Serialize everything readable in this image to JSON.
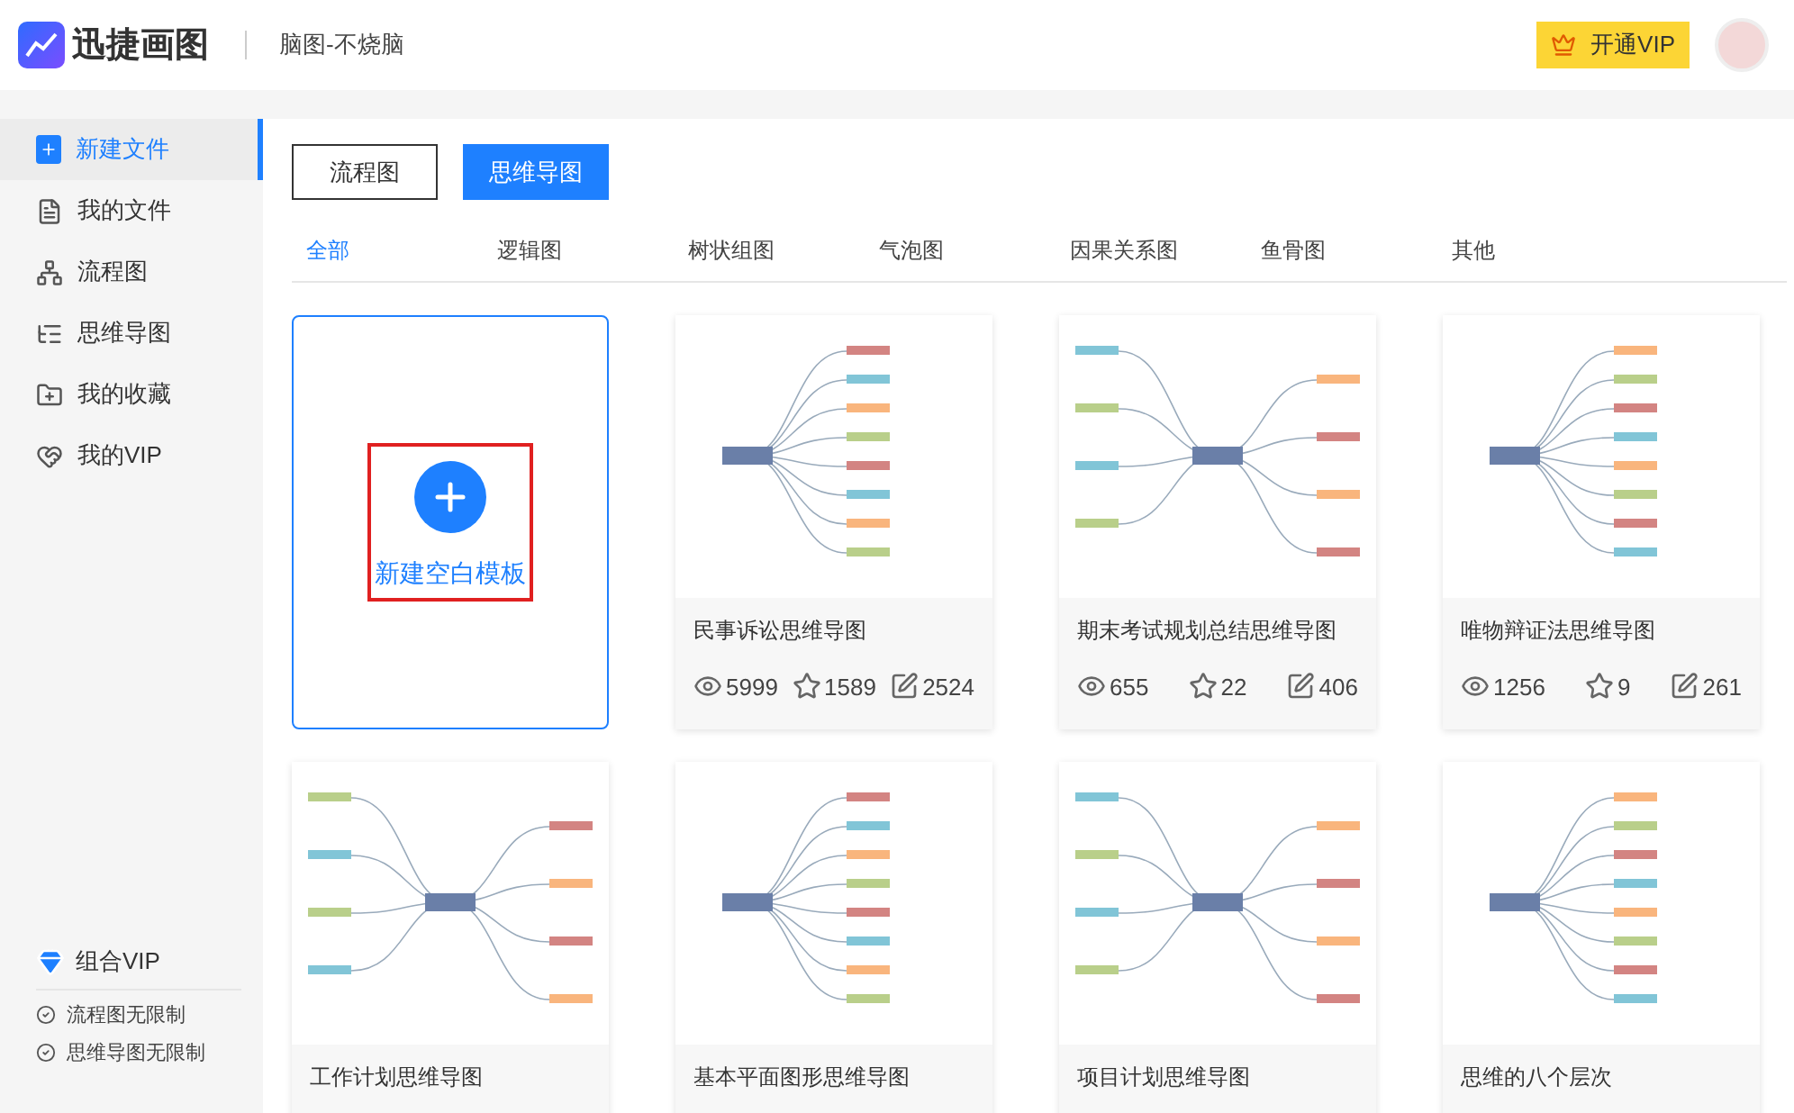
{
  "header": {
    "logo": "迅捷画图",
    "doc_title": "脑图-不烧脑",
    "vip_button": "开通VIP"
  },
  "sidebar": {
    "items": [
      {
        "label": "新建文件",
        "selected": true
      },
      {
        "label": "我的文件",
        "selected": false
      },
      {
        "label": "流程图",
        "selected": false
      },
      {
        "label": "思维导图",
        "selected": false
      },
      {
        "label": "我的收藏",
        "selected": false
      },
      {
        "label": "我的VIP",
        "selected": false
      }
    ],
    "vip": {
      "title": "组合VIP",
      "perks": [
        "流程图无限制",
        "思维导图无限制"
      ]
    }
  },
  "type_buttons": [
    {
      "label": "流程图",
      "selected": false
    },
    {
      "label": "思维导图",
      "selected": true
    }
  ],
  "categories": [
    {
      "label": "全部",
      "selected": true
    },
    {
      "label": "逻辑图",
      "selected": false
    },
    {
      "label": "树状组图",
      "selected": false
    },
    {
      "label": "气泡图",
      "selected": false
    },
    {
      "label": "因果关系图",
      "selected": false
    },
    {
      "label": "鱼骨图",
      "selected": false
    },
    {
      "label": "其他",
      "selected": false
    }
  ],
  "new_card": {
    "label": "新建空白模板"
  },
  "templates": [
    {
      "title": "民事诉讼思维导图",
      "views": "5999",
      "likes": "1589",
      "edits": "2524"
    },
    {
      "title": "期末考试规划总结思维导图",
      "views": "655",
      "likes": "22",
      "edits": "406"
    },
    {
      "title": "唯物辩证法思维导图",
      "views": "1256",
      "likes": "9",
      "edits": "261"
    },
    {
      "title": "工作计划思维导图"
    },
    {
      "title": "基本平面图形思维导图"
    },
    {
      "title": "项目计划思维导图"
    },
    {
      "title": "思维的八个层次"
    }
  ]
}
